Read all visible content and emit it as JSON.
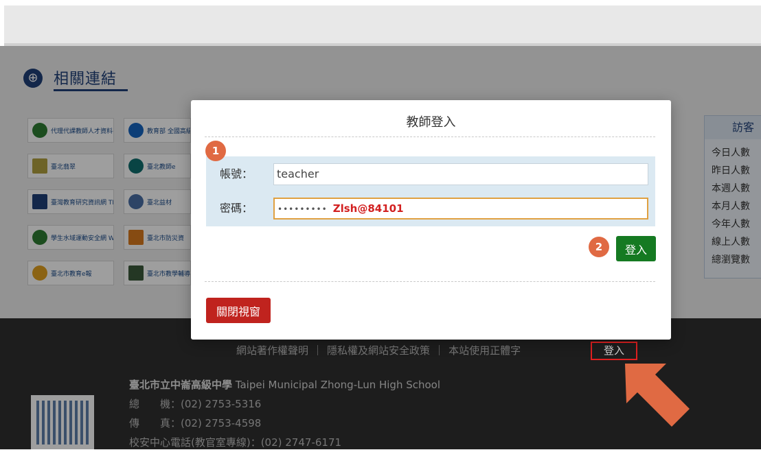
{
  "section": {
    "title": "相關連結"
  },
  "banners": [
    "代理代課教師人才資料平台",
    "教育部 全國高級中等以下學校教師",
    "臺北翡翠",
    "臺北教師e",
    "臺灣教育研究資訊網 TERIC",
    "臺北益材",
    "學生水域運動安全網 WATER SAFETY",
    "臺北市防災資",
    "臺北市教育e報",
    "臺北市教學輔導"
  ],
  "visitors": {
    "title": "訪客",
    "items": [
      "今日人數",
      "昨日人數",
      "本週人數",
      "本月人數",
      "今年人數",
      "線上人數",
      "總瀏覽數"
    ]
  },
  "modal": {
    "title": "教師登入",
    "account_label": "帳號：",
    "account_value": "teacher",
    "password_label": "密碼：",
    "password_mask": "•••••••••",
    "password_hint": "Zlsh@84101",
    "login_button": "登入",
    "close_button": "關閉視窗",
    "step1": "1",
    "step2": "2"
  },
  "footer": {
    "links": [
      "網站著作權聲明",
      "隱私權及網站安全政策",
      "本站使用正體字",
      "登入"
    ],
    "school_name_zh": "臺北市立中崙高級中學",
    "school_name_en": "Taipei Municipal Zhong-Lun High School",
    "phone": "總　　機：(02) 2753-5316",
    "fax": "傳　　真：(02) 2753-4598",
    "safety": "校安中心電話(教官室專線)：(02) 2747-6171"
  },
  "colors": {
    "login_green": "#157a22",
    "close_red": "#c0231e",
    "badge_orange": "#e06a43",
    "arrow_orange": "#e06a43"
  }
}
